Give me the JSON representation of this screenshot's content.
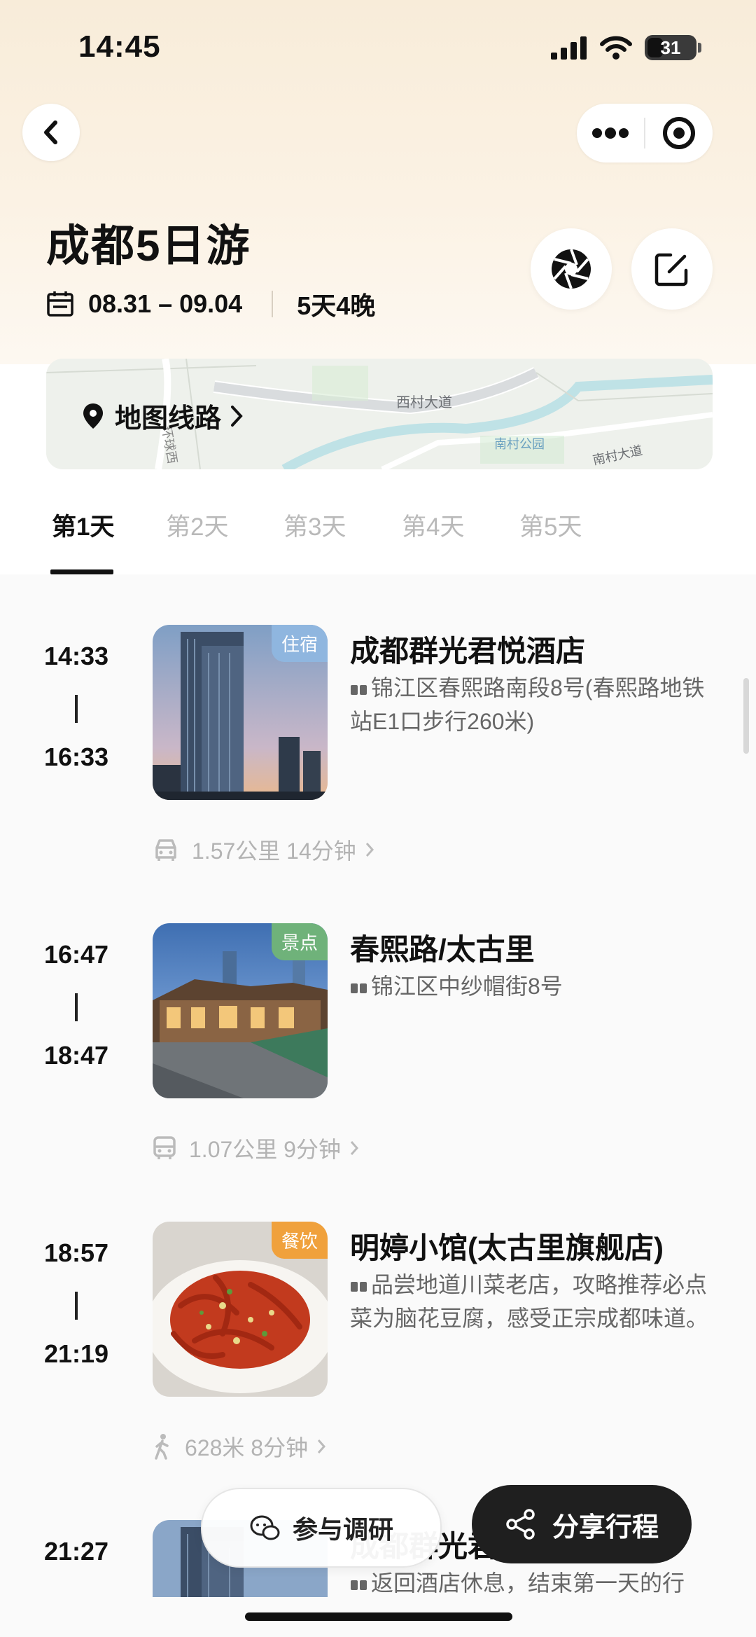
{
  "status_bar": {
    "time": "14:45",
    "battery": "31"
  },
  "header": {
    "title": "成都5日游",
    "dates": "08.31 – 09.04",
    "duration": "5天4晚"
  },
  "map": {
    "label": "地图线路",
    "streets": [
      "西村大道",
      "南村公园",
      "南村大道",
      "环球西"
    ]
  },
  "tabs": [
    {
      "label": "第1天",
      "active": true
    },
    {
      "label": "第2天",
      "active": false
    },
    {
      "label": "第3天",
      "active": false
    },
    {
      "label": "第4天",
      "active": false
    },
    {
      "label": "第5天",
      "active": false
    }
  ],
  "itinerary": [
    {
      "start": "14:33",
      "end": "16:33",
      "badge": "住宿",
      "badge_color": "#8fb6df",
      "title": "成都群光君悦酒店",
      "desc": "锦江区春熙路南段8号(春熙路地铁站E1口步行260米)",
      "transit": {
        "icon": "car-icon",
        "text": "1.57公里 14分钟"
      }
    },
    {
      "start": "16:47",
      "end": "18:47",
      "badge": "景点",
      "badge_color": "#6fb27a",
      "title": "春熙路/太古里",
      "desc": "锦江区中纱帽街8号",
      "transit": {
        "icon": "bus-icon",
        "text": "1.07公里 9分钟"
      }
    },
    {
      "start": "18:57",
      "end": "21:19",
      "badge": "餐饮",
      "badge_color": "#f0a13c",
      "title": "明婷小馆(太古里旗舰店)",
      "desc": "品尝地道川菜老店，攻略推荐必点菜为脑花豆腐，感受正宗成都味道。",
      "transit": {
        "icon": "walk-icon",
        "text": "628米 8分钟"
      }
    },
    {
      "start": "21:27",
      "end": "",
      "title": "成都群光君悦酒店",
      "desc": "返回酒店休息，结束第一天的行"
    }
  ],
  "actions": {
    "survey": "参与调研",
    "share": "分享行程"
  }
}
